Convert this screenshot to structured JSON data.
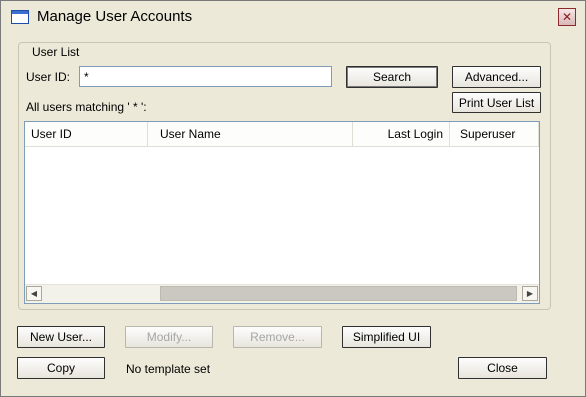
{
  "window": {
    "title": "Manage User Accounts",
    "close_glyph": "✕"
  },
  "user_list": {
    "group_label": "User List",
    "user_id_label": "User ID:",
    "user_id_value": "*",
    "matching_text": "All users matching ' * ':",
    "buttons": {
      "search": "Search",
      "advanced": "Advanced...",
      "print_user_list": "Print User List"
    },
    "columns": [
      "User ID",
      "User Name",
      "Last Login",
      "Superuser"
    ],
    "rows": []
  },
  "actions": {
    "new_user": "New User...",
    "modify": "Modify...",
    "remove": "Remove...",
    "simplified_ui": "Simplified UI",
    "copy": "Copy",
    "close": "Close"
  },
  "status": {
    "template": "No template set"
  },
  "icons": {
    "scroll_left": "arrow-left-icon",
    "scroll_right": "arrow-right-icon",
    "close": "close-icon",
    "window": "window-icon"
  }
}
